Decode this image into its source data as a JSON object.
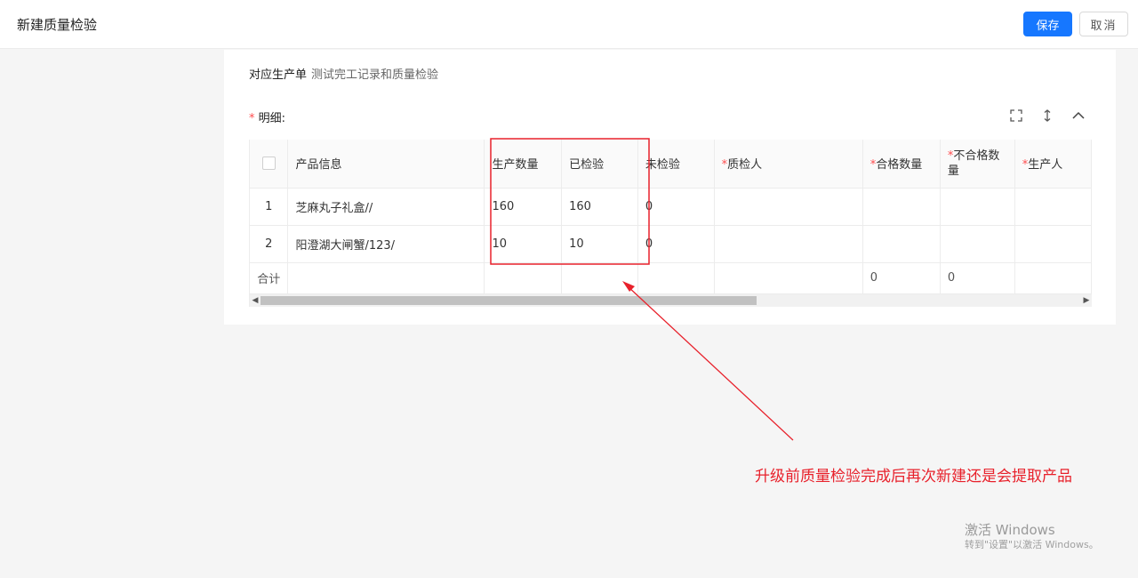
{
  "header": {
    "title": "新建质量检验",
    "save_label": "保存",
    "cancel_label": "取消"
  },
  "form": {
    "order_label": "对应生产单",
    "order_value": "测试完工记录和质量检验",
    "detail_required_mark": "*",
    "detail_label": "明细:"
  },
  "toolbar_icons": [
    "fullscreen-icon",
    "row-height-icon",
    "collapse-icon"
  ],
  "table": {
    "columns": [
      {
        "label": "",
        "required": false
      },
      {
        "label": "产品信息",
        "required": false
      },
      {
        "label": "生产数量",
        "required": false
      },
      {
        "label": "已检验",
        "required": false
      },
      {
        "label": "未检验",
        "required": false
      },
      {
        "label": "质检人",
        "required": true
      },
      {
        "label": "合格数量",
        "required": true
      },
      {
        "label": "不合格数量",
        "required": true
      },
      {
        "label": "生产人",
        "required": true
      }
    ],
    "required_mark": "*",
    "rows": [
      {
        "index": "1",
        "product": "芝麻丸子礼盒//",
        "produced": "160",
        "inspected": "160",
        "uninspected": "0",
        "inspector": "",
        "qualified": "",
        "unqualified": "",
        "producer": ""
      },
      {
        "index": "2",
        "product": "阳澄湖大闸蟹/123/",
        "produced": "10",
        "inspected": "10",
        "uninspected": "0",
        "inspector": "",
        "qualified": "",
        "unqualified": "",
        "producer": ""
      }
    ],
    "total": {
      "label": "合计",
      "qualified": "0",
      "unqualified": "0"
    }
  },
  "annotation": {
    "text": "升级前质量检验完成后再次新建还是会提取产品",
    "color": "#e8212b"
  },
  "watermark": {
    "line1": "激活 Windows",
    "line2": "转到\"设置\"以激活 Windows。"
  },
  "colors": {
    "primary": "#1677ff",
    "required": "#ff4d4f"
  }
}
